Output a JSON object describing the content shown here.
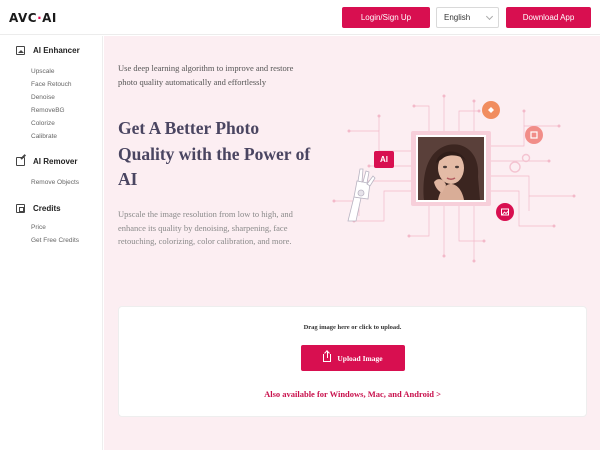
{
  "brand": {
    "name_left": "AVC",
    "separator": "·",
    "name_right": "AI"
  },
  "header": {
    "login_label": "Login/Sign Up",
    "language_selected": "English",
    "download_label": "Download App"
  },
  "sidebar": {
    "sections": [
      {
        "title": "AI Enhancer",
        "icon": "image-icon",
        "items": [
          "Upscale",
          "Face Retouch",
          "Denoise",
          "RemoveBG",
          "Colorize",
          "Calibrate"
        ]
      },
      {
        "title": "AI Remover",
        "icon": "edit-icon",
        "items": [
          "Remove Objects"
        ]
      },
      {
        "title": "Credits",
        "icon": "wallet-icon",
        "items": [
          "Price",
          "Get Free Credits"
        ]
      }
    ]
  },
  "hero": {
    "intro": "Use deep learning algorithm to improve and restore photo quality automatically and effortlessly",
    "headline": "Get A Better Photo Quality with the Power of AI",
    "description": "Upscale the image resolution from low to high, and enhance its quality by denoising, sharpening, face retouching, colorizing, color calibration, and more.",
    "ai_badge": "AI"
  },
  "upload": {
    "hint": "Drag image here or click to upload.",
    "button_label": "Upload Image",
    "platforms_link": "Also available for Windows, Mac, and Android >"
  },
  "colors": {
    "accent": "#d80f50",
    "main_background": "#fceef2",
    "headline": "#4a4561"
  }
}
